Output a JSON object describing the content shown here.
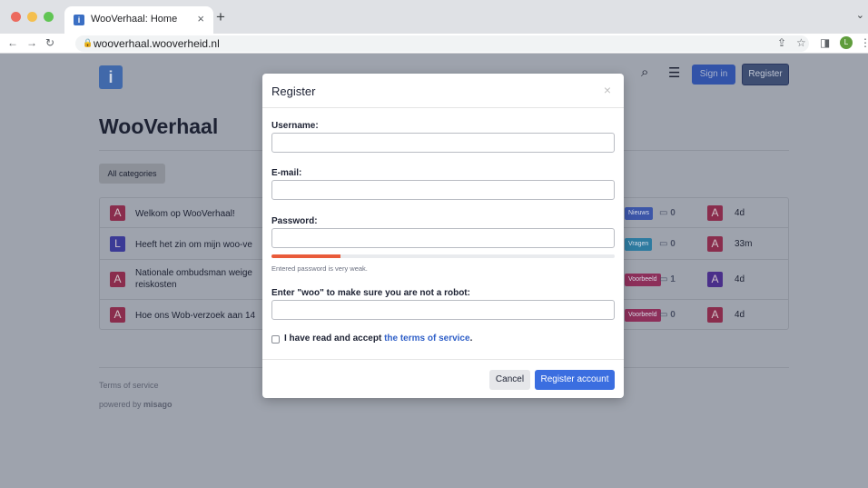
{
  "browser": {
    "tab_title": "WooVerhaal: Home",
    "tab_favicon": "i",
    "url": "wooverhaal.wooverheid.nl",
    "profile_initial": "L"
  },
  "header": {
    "logo_letter": "i",
    "sign_in_label": "Sign in",
    "register_label": "Register"
  },
  "page": {
    "title": "WooVerhaal",
    "all_categories_label": "All categories"
  },
  "threads": [
    {
      "avatar": "A",
      "avatar_color": "#8a2d4d",
      "title": "Welkom op WooVerhaal!",
      "title2": "",
      "badge": "Nieuws",
      "badge_color": "#3c56a8",
      "replies": "0",
      "last_avatar": "A",
      "last_color": "#8a2d4d",
      "time": "4d"
    },
    {
      "avatar": "L",
      "avatar_color": "#3b3a96",
      "title": "Heeft het zin om mijn woo-ve",
      "title2": "",
      "badge": "Vragen",
      "badge_color": "#2e7ba0",
      "replies": "0",
      "last_avatar": "A",
      "last_color": "#8a2d4d",
      "time": "33m"
    },
    {
      "avatar": "A",
      "avatar_color": "#8a2d4d",
      "title": "Nationale ombudsman weige",
      "title2": "reiskosten",
      "badge": "Voorbeeld",
      "badge_color": "#8d2f5a",
      "replies": "1",
      "last_avatar": "A",
      "last_color": "#4a2f8a",
      "time": "4d"
    },
    {
      "avatar": "A",
      "avatar_color": "#8a2d4d",
      "title": "Hoe ons Wob-verzoek aan 14",
      "title2": "",
      "badge": "Voorbeeld",
      "badge_color": "#8d2f5a",
      "replies": "0",
      "last_avatar": "A",
      "last_color": "#8a2d4d",
      "time": "4d"
    }
  ],
  "footer": {
    "terms_label": "Terms of service",
    "powered_prefix": "powered by ",
    "powered_brand": "misago"
  },
  "modal": {
    "title": "Register",
    "close_glyph": "×",
    "username_label": "Username:",
    "username_value": "",
    "email_label": "E-mail:",
    "email_value": "",
    "password_label": "Password:",
    "password_value": "",
    "password_strength": 0.2,
    "strength_text": "Entered password is very weak.",
    "robot_label": "Enter \"woo\" to make sure you are not a robot:",
    "robot_value": "",
    "tos_prefix": "I have read and accept ",
    "tos_link": "the terms of service",
    "tos_suffix": ".",
    "cancel_label": "Cancel",
    "submit_label": "Register account"
  }
}
